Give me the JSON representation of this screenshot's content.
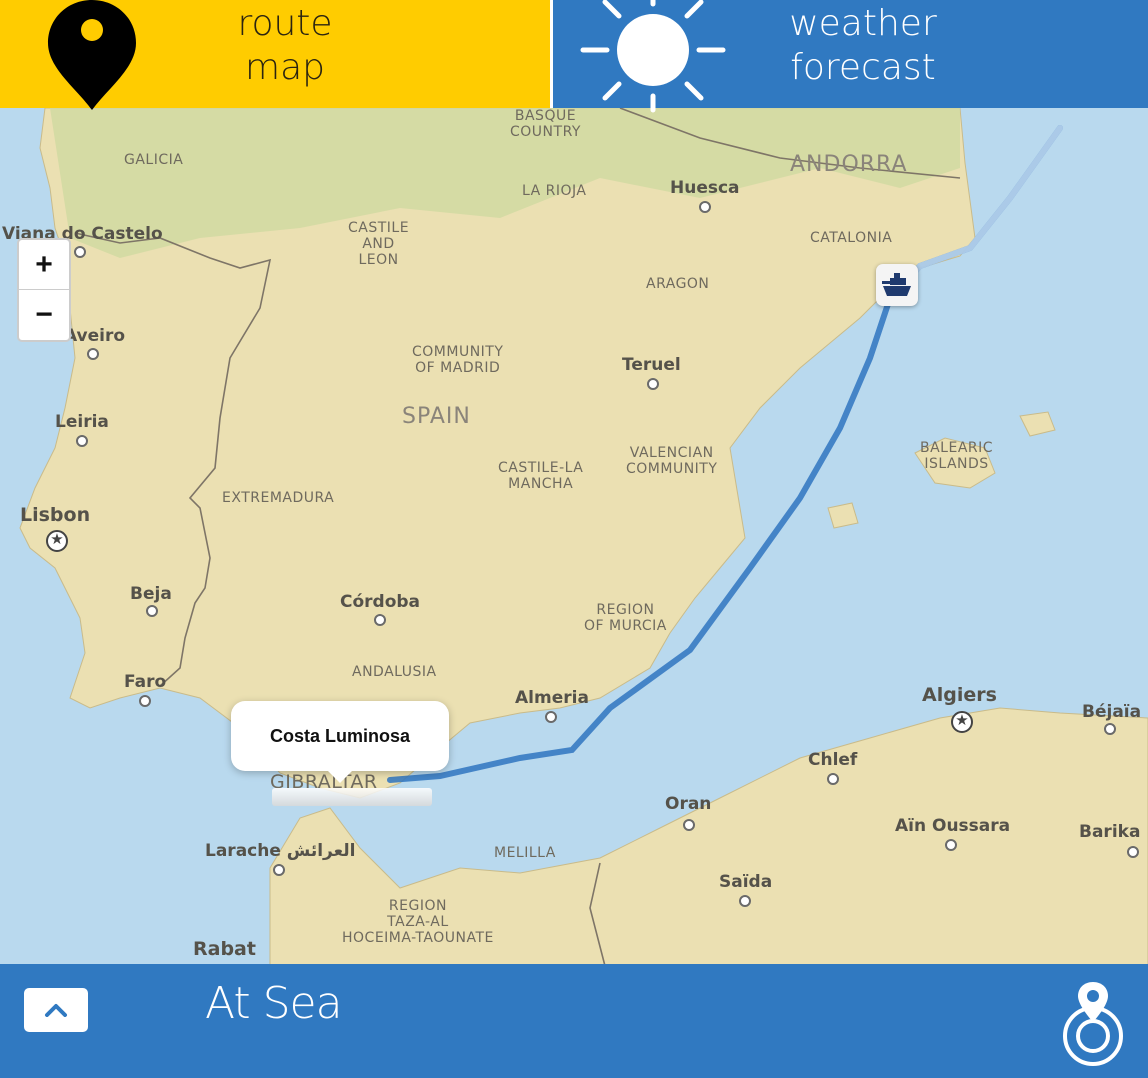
{
  "tabs": {
    "route": {
      "line1": "route",
      "line2": "map",
      "icon": "map-pin-icon",
      "color": "#ffcc00"
    },
    "weather": {
      "line1": "weather",
      "line2": "forecast",
      "icon": "sun-icon",
      "color": "#3079c1"
    }
  },
  "map": {
    "zoom_in": "+",
    "zoom_out": "−",
    "ship_popup": "Costa Luminosa",
    "port_icon": "ship-icon",
    "regions": {
      "galicia": "GALICIA",
      "basque": [
        "BASQUE",
        "COUNTRY"
      ],
      "andorra": "ANDORRA",
      "la_rioja": "LA RIOJA",
      "castile_leon": [
        "CASTILE",
        "AND",
        "LEON"
      ],
      "catalonia": "CATALONIA",
      "aragon": "ARAGON",
      "madrid": [
        "COMMUNITY",
        "OF MADRID"
      ],
      "spain": "SPAIN",
      "balearic": [
        "BALEARIC",
        "ISLANDS"
      ],
      "castile_mancha": [
        "CASTILE-LA",
        "MANCHA"
      ],
      "valencian": [
        "VALENCIAN",
        "COMMUNITY"
      ],
      "extremadura": "EXTREMADURA",
      "murcia": [
        "REGION",
        "OF MURCIA"
      ],
      "andalusia": "ANDALUSIA",
      "melilla": "MELILLA",
      "taza": [
        "REGION",
        "TAZA-AL",
        "HOCEIMA-TAOUNATE"
      ]
    },
    "cities": {
      "viana": "Viana do Castelo",
      "huesca": "Huesca",
      "aveiro": "Aveiro",
      "teruel": "Teruel",
      "leiria": "Leiria",
      "lisbon": "Lisbon",
      "beja": "Beja",
      "cordoba": "Córdoba",
      "faro": "Faro",
      "almeria": "Almeria",
      "algiers": "Algiers",
      "bejaia": "Béjaïa",
      "chlef": "Chlef",
      "oran": "Oran",
      "ain_oussara": "Aïn Oussara",
      "barika": "Barika",
      "larache": "Larache العرائش",
      "saida": "Saïda",
      "rabat": "Rabat",
      "gibraltar": "GIBRALTAR"
    }
  },
  "bottom": {
    "status": "At Sea",
    "expand_icon": "chevron-up-icon",
    "locate_icon": "locate-target-icon",
    "color": "#3079c1"
  }
}
